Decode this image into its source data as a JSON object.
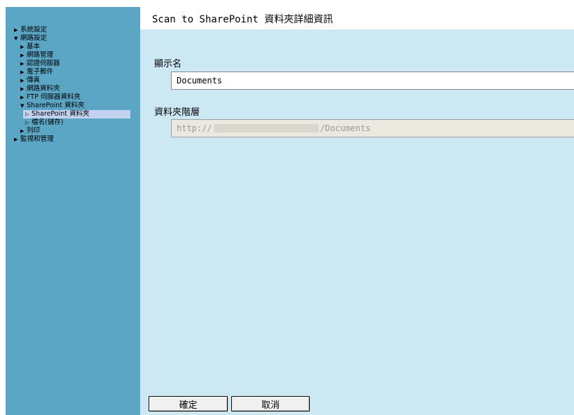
{
  "sidebar": {
    "items": [
      {
        "label": "系統設定",
        "arrow": "▶"
      },
      {
        "label": "網路設定",
        "arrow": "▼"
      },
      {
        "label": "基本",
        "arrow": "▶"
      },
      {
        "label": "網路管理",
        "arrow": "▶"
      },
      {
        "label": "認證伺服器",
        "arrow": "▶"
      },
      {
        "label": "電子郵件",
        "arrow": "▶"
      },
      {
        "label": "傳真",
        "arrow": "▶"
      },
      {
        "label": "網路資料夾",
        "arrow": "▶"
      },
      {
        "label": "FTP 伺服器資料夾",
        "arrow": "▶"
      },
      {
        "label": "SharePoint 資料夾",
        "arrow": "▼"
      },
      {
        "label": "SharePoint 資料夾",
        "arrow": "▷"
      },
      {
        "label": "檔名(儲存)",
        "arrow": "▷"
      },
      {
        "label": "列印",
        "arrow": "▶"
      },
      {
        "label": "監視和管理",
        "arrow": "▶"
      }
    ]
  },
  "main": {
    "title": "Scan to SharePoint 資料夾詳細資訊",
    "display_name": {
      "label": "顯示名",
      "value": "Documents"
    },
    "folder_path": {
      "label": "資料夾階層",
      "prefix": "http://",
      "suffix": "/Documents"
    }
  },
  "buttons": {
    "ok": "確定",
    "cancel": "取消"
  },
  "colors": {
    "sidebar_bg": "#5aa6c4",
    "main_bg": "#cce8f3",
    "selected_item_bg": "#c3d3ef",
    "disabled_field_bg": "#ebe8df"
  }
}
